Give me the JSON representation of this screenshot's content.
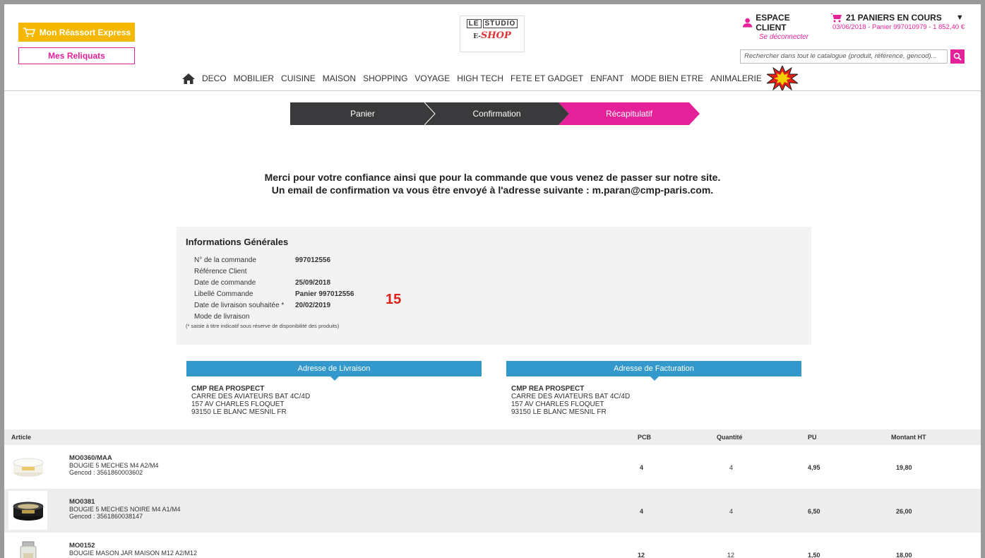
{
  "header": {
    "reassort_label": "Mon Réassort Express",
    "reliquats_label": "Mes Reliquats",
    "logo_line1_a": "LE",
    "logo_line1_b": "STUDIO",
    "logo_line2_pre": "E-",
    "logo_line2": "SHOP",
    "espace_title": "ESPACE CLIENT",
    "deconnecter": "Se déconnecter",
    "paniers_title": "21 PANIERS EN COURS",
    "paniers_sub": "03/06/2018 - Panier 997010979 - 1 852,40 €",
    "search_placeholder": "Rechercher dans tout le catalogue (produit, référence, gencod)..."
  },
  "nav": [
    "DECO",
    "MOBILIER",
    "CUISINE",
    "MAISON",
    "SHOPPING",
    "VOYAGE",
    "HIGH TECH",
    "FETE ET GADGET",
    "ENFANT",
    "MODE BIEN ETRE",
    "ANIMALERIE"
  ],
  "steps": [
    "Panier",
    "Confirmation",
    "Récapitulatif"
  ],
  "merci": {
    "line1": "Merci pour votre confiance ainsi que pour la commande que vous venez de passer sur notre site.",
    "line2": "Un email de confirmation va vous être envoyé à l'adresse suivante : m.paran@cmp-paris.com."
  },
  "infos": {
    "title": "Informations Générales",
    "rows": [
      {
        "label": "N° de la commande",
        "value": "997012556"
      },
      {
        "label": "Référence Client",
        "value": ""
      },
      {
        "label": "Date de commande",
        "value": "25/09/2018"
      },
      {
        "label": "Libellé Commande",
        "value": "Panier 997012556"
      },
      {
        "label": "Date de livraison souhaitée *",
        "value": "20/02/2019"
      },
      {
        "label": "Mode de livraison",
        "value": ""
      }
    ],
    "note": "(* saisie à titre indicatif sous réserve de disponibilité des produits)",
    "annotation": "15"
  },
  "livraison": {
    "title": "Adresse de Livraison",
    "name": "CMP REA PROSPECT",
    "line1": "CARRE DES AVIATEURS BAT 4C/4D",
    "line2": "157 AV CHARLES FLOQUET",
    "line3": "93150 LE BLANC MESNIL FR"
  },
  "facturation": {
    "title": "Adresse de Facturation",
    "name": "CMP REA PROSPECT",
    "line1": "CARRE DES AVIATEURS BAT 4C/4D",
    "line2": "157 AV CHARLES FLOQUET",
    "line3": "93150 LE BLANC MESNIL FR"
  },
  "table": {
    "headers": {
      "article": "Article",
      "pcb": "PCB",
      "quantite": "Quantité",
      "pu": "PU",
      "montant": "Montant HT"
    },
    "rows": [
      {
        "ref": "MO0360/MAA",
        "desc": "BOUGIE 5 MECHES M4 A2/M4",
        "gencod": "Gencod : 3561860003602",
        "pcb": "4",
        "qty": "4",
        "pu": "4,95",
        "montant": "19,80"
      },
      {
        "ref": "MO0381",
        "desc": "BOUGIE 5 MECHES NOIRE M4 A1/M4",
        "gencod": "Gencod : 3561860038147",
        "pcb": "4",
        "qty": "4",
        "pu": "6,50",
        "montant": "26,00"
      },
      {
        "ref": "MO0152",
        "desc": "BOUGIE MASON JAR MAISON M12 A2/M12",
        "gencod": "",
        "pcb": "12",
        "qty": "12",
        "pu": "1,50",
        "montant": "18,00"
      }
    ]
  },
  "colors": {
    "pink": "#e5219a",
    "blue": "#3399cc",
    "dark": "#3a3a3c",
    "yellow": "#f5b800",
    "red": "#e0201a"
  }
}
